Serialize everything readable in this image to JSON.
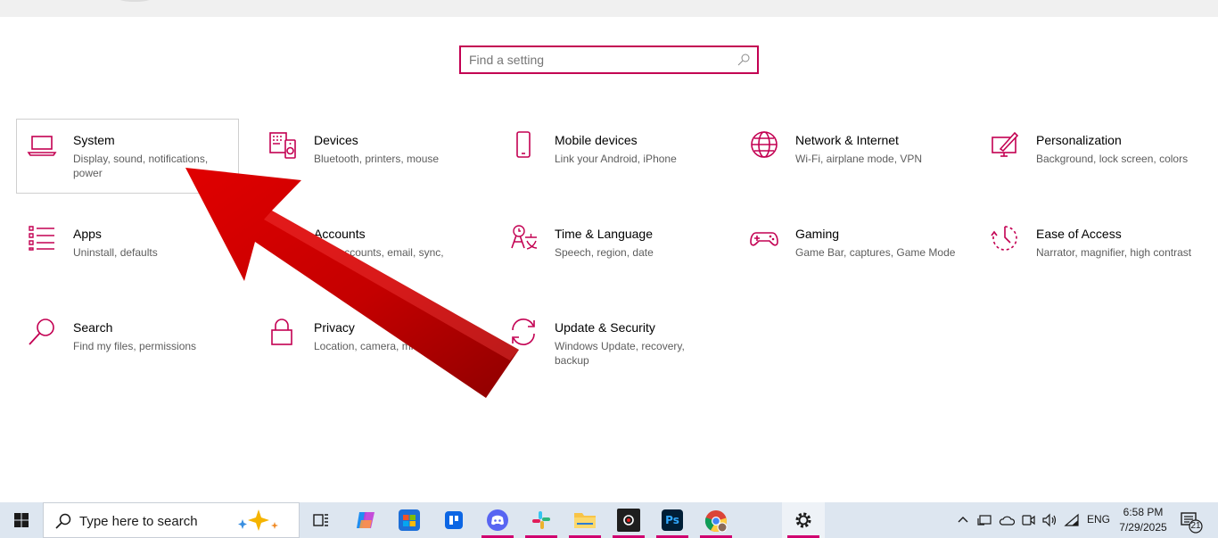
{
  "search": {
    "placeholder": "Find a setting"
  },
  "tiles": [
    {
      "title": "System",
      "desc": "Display, sound, notifications, power",
      "icon": "laptop-icon",
      "selected": true
    },
    {
      "title": "Devices",
      "desc": "Bluetooth, printers, mouse",
      "icon": "keyboard-speaker-icon"
    },
    {
      "title": "Mobile devices",
      "desc": "Link your Android, iPhone",
      "icon": "phone-icon"
    },
    {
      "title": "Network & Internet",
      "desc": "Wi-Fi, airplane mode, VPN",
      "icon": "globe-icon"
    },
    {
      "title": "Personalization",
      "desc": "Background, lock screen, colors",
      "icon": "paint-monitor-icon"
    },
    {
      "title": "Apps",
      "desc": "Uninstall, defaults",
      "icon": "apps-list-icon"
    },
    {
      "title": "Accounts",
      "desc": "Your accounts, email, sync,",
      "icon": "person-icon"
    },
    {
      "title": "Time & Language",
      "desc": "Speech, region, date",
      "icon": "time-language-icon"
    },
    {
      "title": "Gaming",
      "desc": "Game Bar, captures, Game Mode",
      "icon": "gamepad-icon"
    },
    {
      "title": "Ease of Access",
      "desc": "Narrator, magnifier, high contrast",
      "icon": "ease-of-access-icon"
    },
    {
      "title": "Search",
      "desc": "Find my files, permissions",
      "icon": "magnifier-icon"
    },
    {
      "title": "Privacy",
      "desc": "Location, camera, mi",
      "icon": "lock-icon"
    },
    {
      "title": "Update & Security",
      "desc": "Windows Update, recovery, backup",
      "icon": "sync-arrows-icon"
    }
  ],
  "taskbar": {
    "search_text": "Type here to search",
    "apps": [
      {
        "name": "task-view",
        "icon": "task-view-icon"
      },
      {
        "name": "copilot",
        "icon": "copilot-icon"
      },
      {
        "name": "microsoft-store",
        "icon": "store-icon"
      },
      {
        "name": "trello",
        "icon": "trello-icon"
      },
      {
        "name": "discord",
        "icon": "discord-icon"
      },
      {
        "name": "slack",
        "icon": "slack-icon"
      },
      {
        "name": "file-explorer",
        "icon": "folder-icon"
      },
      {
        "name": "obs",
        "icon": "obs-icon"
      },
      {
        "name": "photoshop",
        "icon": "photoshop-icon",
        "label": "Ps"
      },
      {
        "name": "chrome",
        "icon": "chrome-icon"
      },
      {
        "name": "settings",
        "icon": "gear-icon"
      }
    ],
    "language": "ENG",
    "time": "6:58 PM",
    "date": "7/29/2025",
    "notification_count": "21"
  },
  "colors": {
    "accent": "#c30052",
    "arrow": "#cc0000"
  }
}
